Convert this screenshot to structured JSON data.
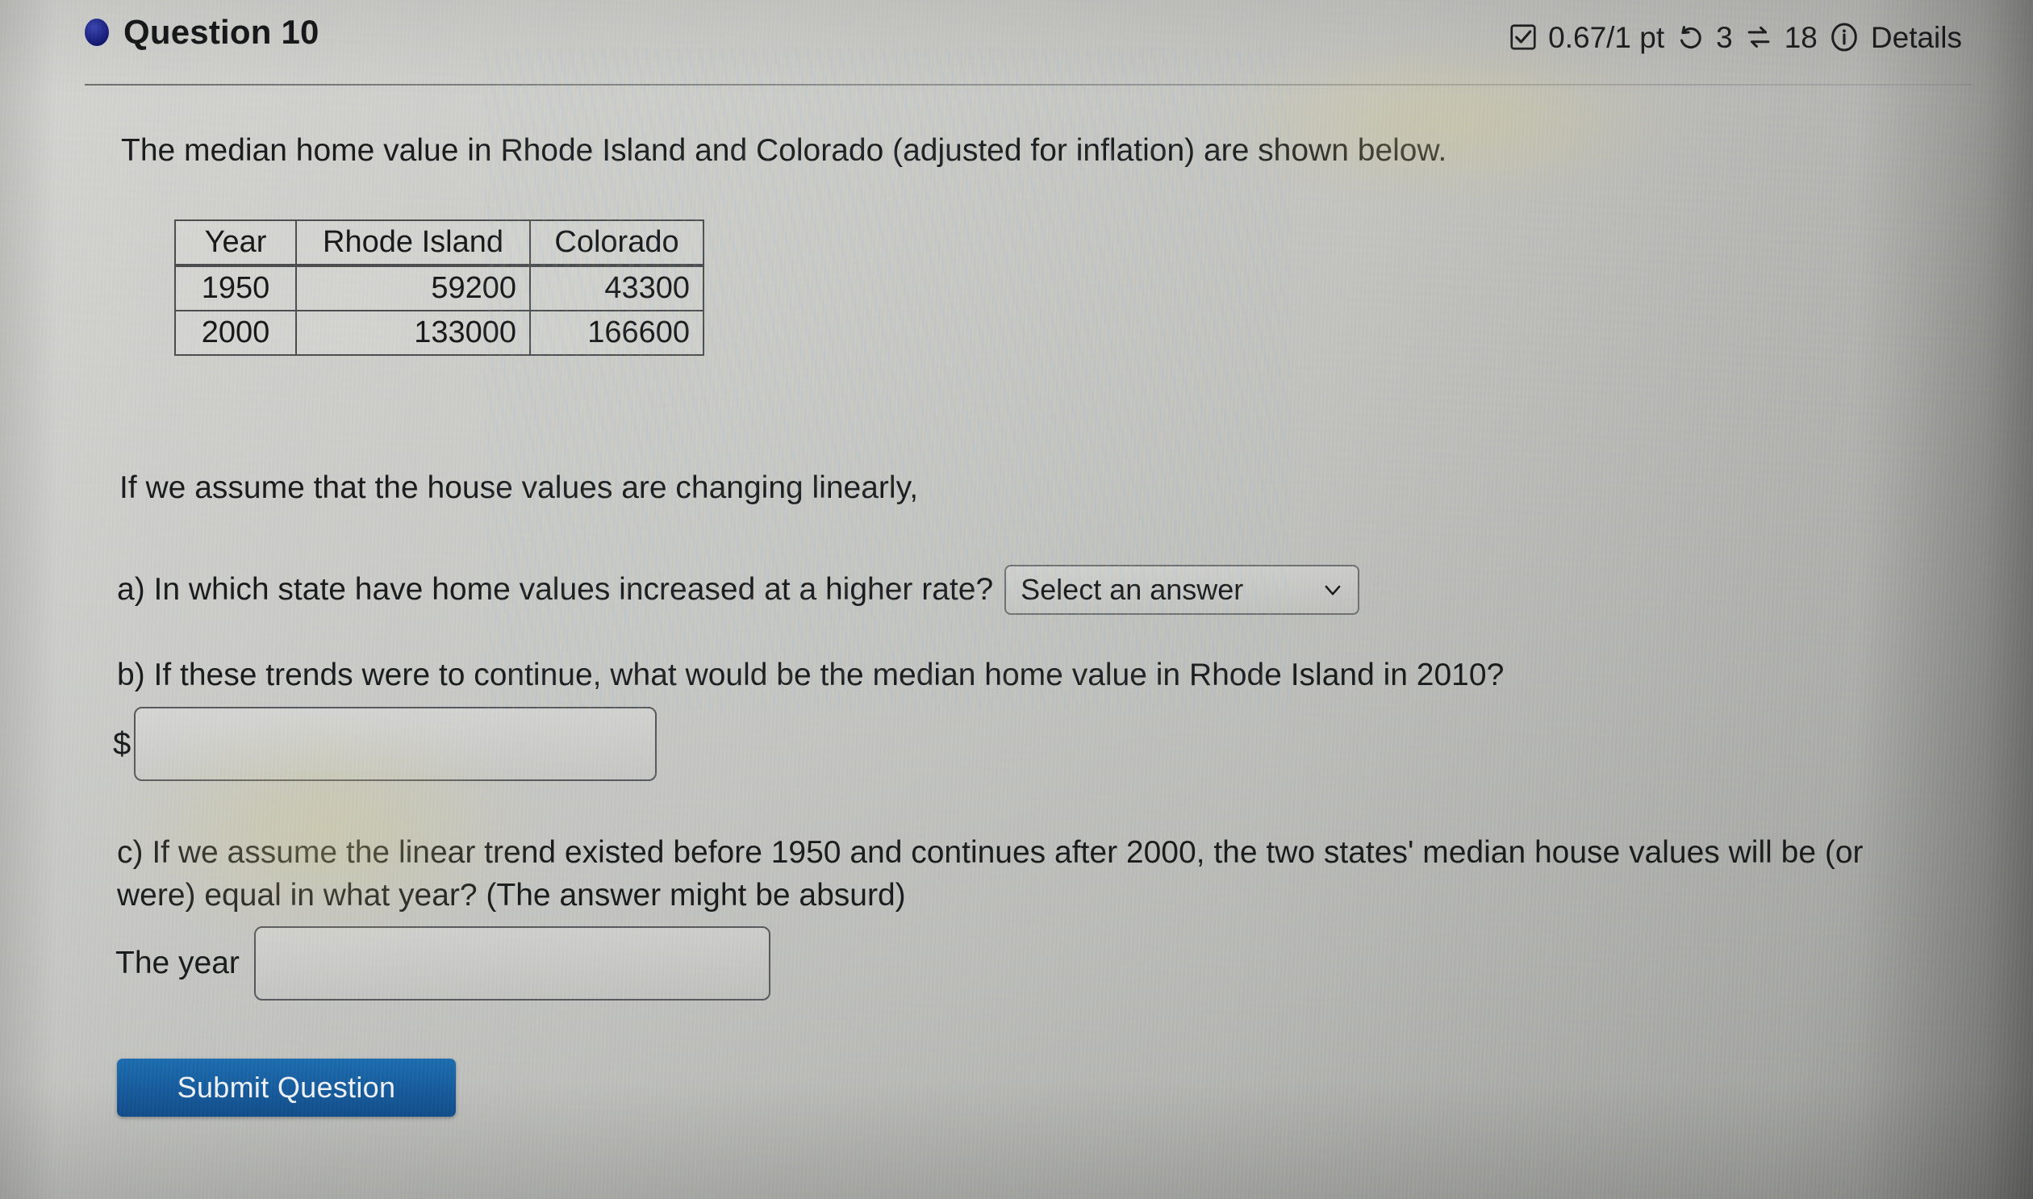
{
  "header": {
    "bullet_icon": "filled-circle-icon",
    "title": "Question 10",
    "score_icon": "checked-checkbox-icon",
    "score": "0.67/1 pt",
    "attempts_icon": "undo-arrow-icon",
    "attempts": "3",
    "tries_icon": "swap-arrows-icon",
    "tries": "18",
    "details_icon": "info-circle-icon",
    "details_label": "Details"
  },
  "question": {
    "prompt": "The median home value in Rhode Island and Colorado (adjusted for inflation) are shown below.",
    "assume_line": "If we assume that the house values are changing linearly,",
    "part_a": {
      "text": "a) In which state have home values increased at a higher rate?",
      "select_value": "Select an answer",
      "select_caret_icon": "chevron-down-icon",
      "options": [
        "Select an answer",
        "Rhode Island",
        "Colorado"
      ]
    },
    "part_b": {
      "text": "b) If these trends were to continue, what would be the median home value in Rhode Island in 2010?",
      "currency_prefix": "$",
      "input_value": "",
      "input_placeholder": ""
    },
    "part_c": {
      "text": "c) If we assume the linear trend existed before 1950 and continues after 2000, the two states' median house values will be (or were) equal in what year? (The answer might be absurd)",
      "label": "The year",
      "input_value": "",
      "input_placeholder": ""
    },
    "submit_label": "Submit Question"
  },
  "table": {
    "columns": [
      "Year",
      "Rhode Island",
      "Colorado"
    ],
    "rows": [
      [
        "1950",
        "59200",
        "43300"
      ],
      [
        "2000",
        "133000",
        "166600"
      ]
    ]
  },
  "colors": {
    "page_background": "#c4c5c2",
    "text": "#1a1b1d",
    "bullet_blue": "#1b2176",
    "submit_blue": "#17599a",
    "divider_gray": "#6d6e70"
  }
}
